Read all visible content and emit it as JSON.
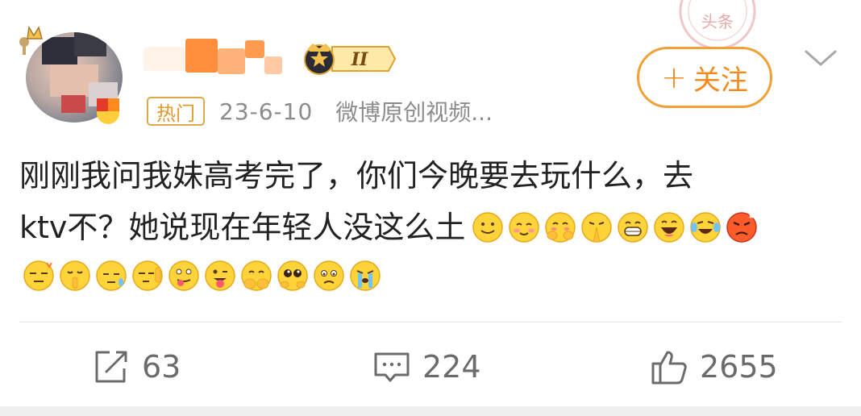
{
  "post": {
    "follow_label": "关注",
    "follow_plus": "+",
    "hot_tag": "热门",
    "date": "23-6-10",
    "source": "微博原创视频...",
    "level_badge": "II",
    "stamp_text": "头条",
    "content_line1": "刚刚我问我妹高考完了，你们今晚要去玩什么，去",
    "content_line2": "ktv不？她说现在年轻人没这么土",
    "emojis_line1": [
      "smile",
      "blush",
      "shy",
      "pray",
      "grin",
      "laugh",
      "tears-of-joy",
      "angry"
    ],
    "emojis_line2": [
      "doge-wink",
      "shush",
      "sweat",
      "facepalm",
      "tongue",
      "tongue-out",
      "cover-face",
      "puppy-eyes",
      "sad",
      "crying"
    ]
  },
  "actions": {
    "repost_count": "63",
    "comment_count": "224",
    "like_count": "2655"
  },
  "colors": {
    "accent": "#f28a1c",
    "text": "#222222",
    "meta": "#8c8c8c"
  }
}
